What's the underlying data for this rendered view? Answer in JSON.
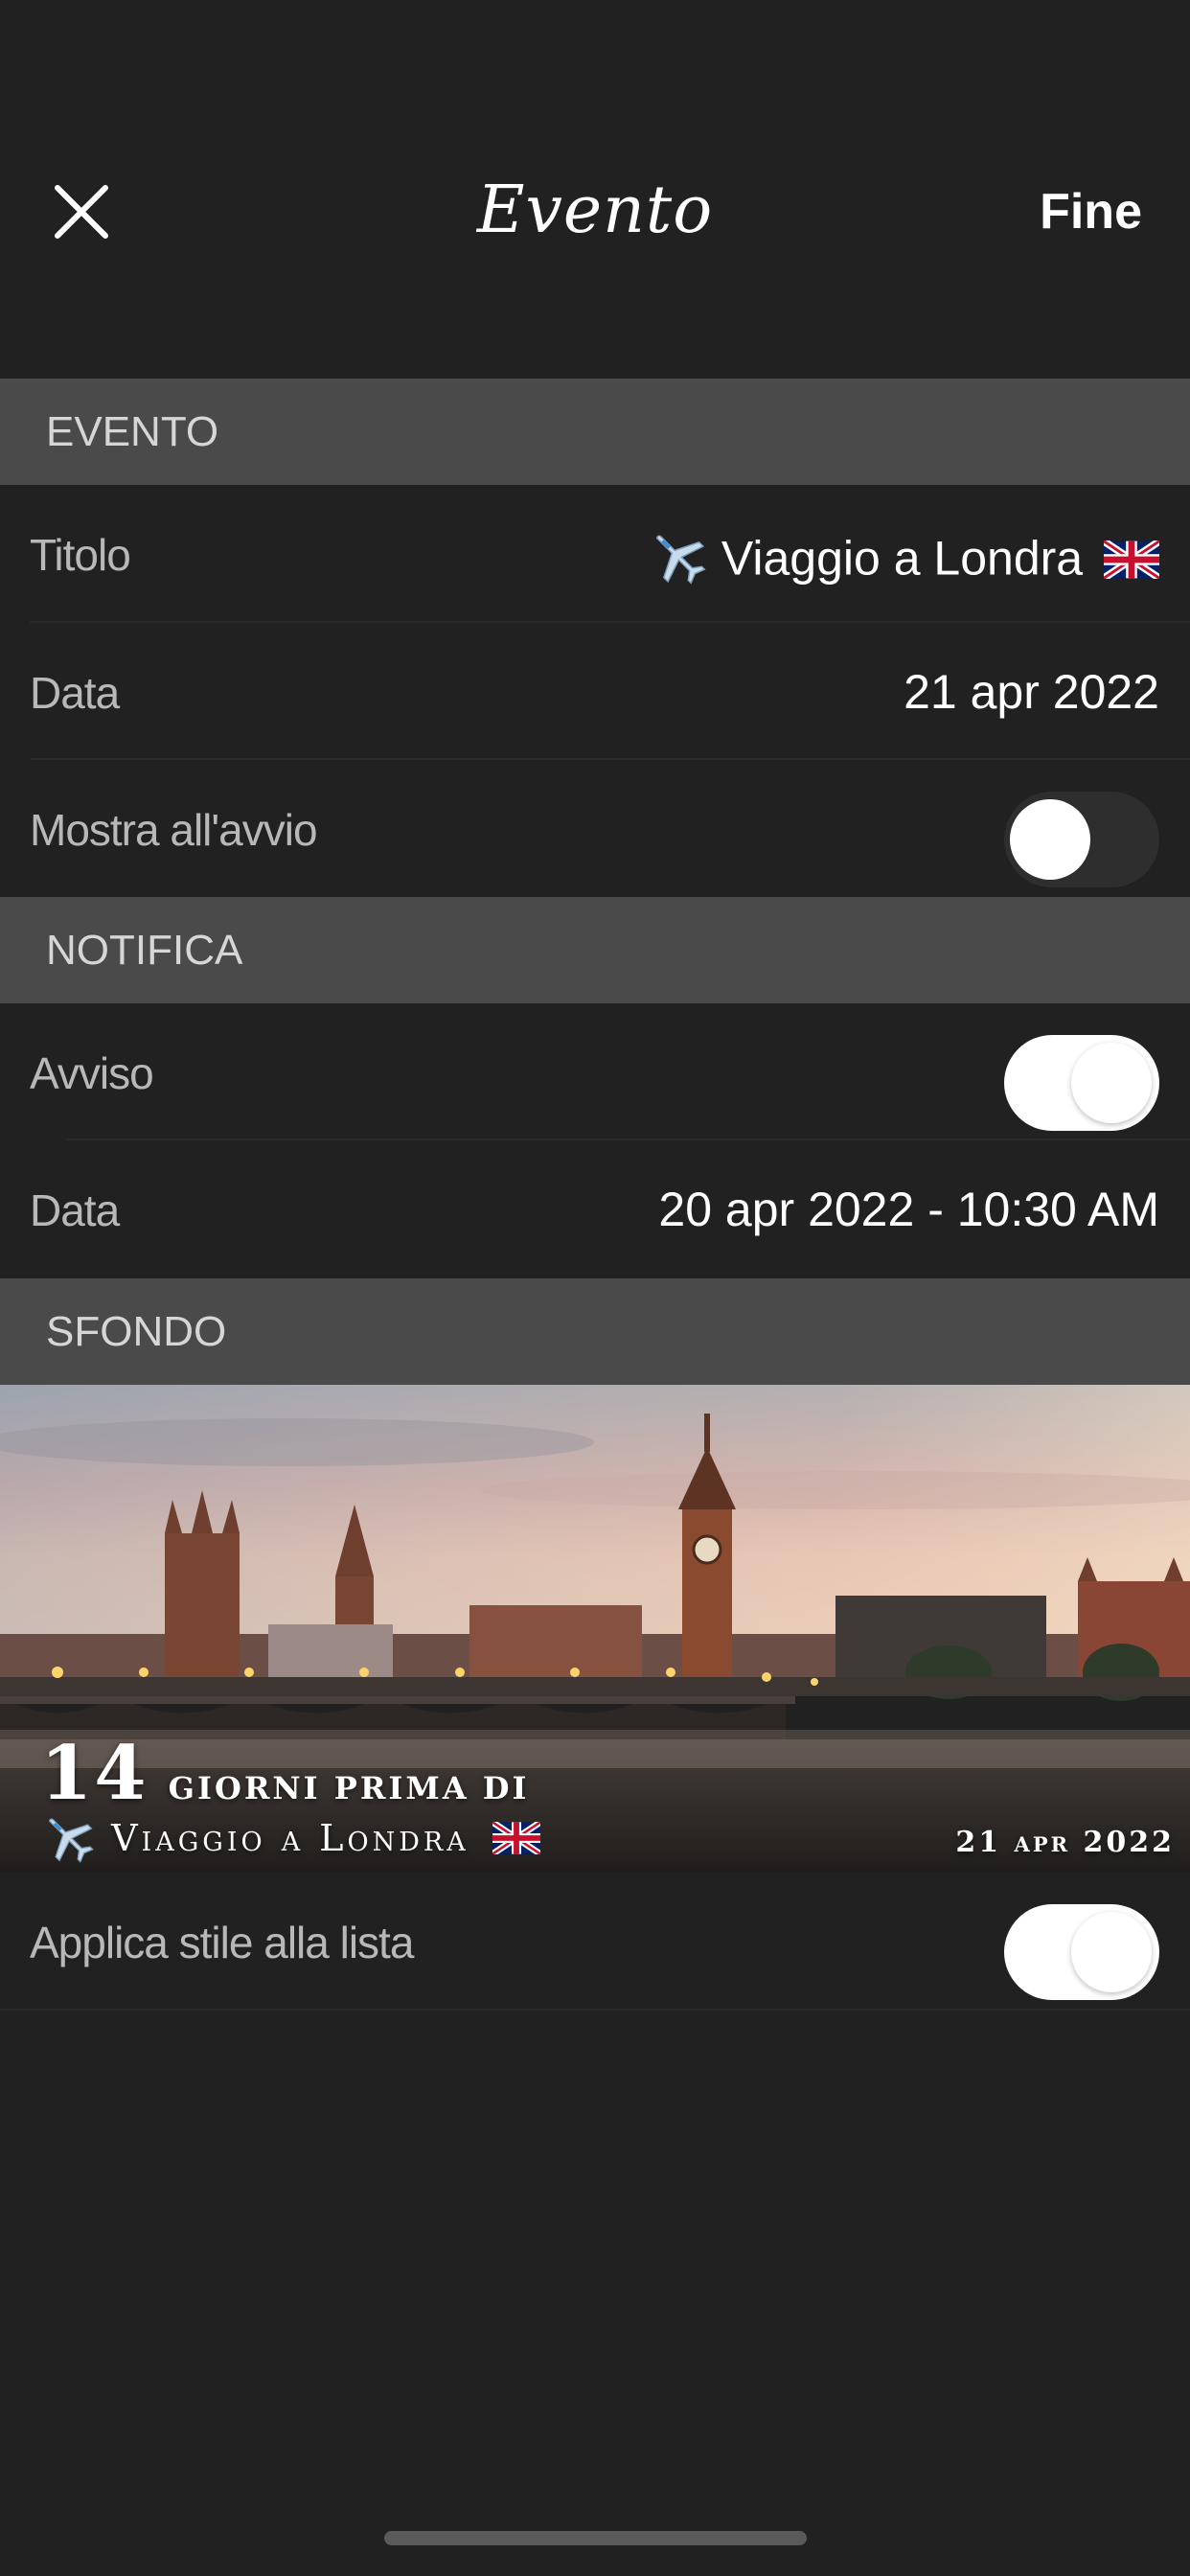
{
  "nav": {
    "title": "Evento",
    "done_label": "Fine",
    "close_icon": "close-icon"
  },
  "sections": {
    "evento": "EVENTO",
    "notifica": "NOTIFICA",
    "sfondo": "SFONDO"
  },
  "event": {
    "title_label": "Titolo",
    "title_value": "Viaggio a Londra",
    "title_icons": [
      "airplane-icon",
      "uk-flag-icon"
    ],
    "date_label": "Data",
    "date_value": "21 apr 2022",
    "show_on_launch_label": "Mostra all'avvio",
    "show_on_launch": false
  },
  "notification": {
    "alert_label": "Avviso",
    "alert_enabled": true,
    "date_label": "Data",
    "date_value": "20 apr 2022 - 10:30 AM"
  },
  "background": {
    "days_number": "14",
    "days_text": "giorni prima di",
    "event_name": "Viaggio a Londra",
    "event_date": "21 apr 2022",
    "apply_style_label": "Applica stile alla lista",
    "apply_style_enabled": true
  },
  "colors": {
    "background": "#212121",
    "section_header": "#4a4a4a",
    "label": "#b8b8b8",
    "value": "#ffffff"
  }
}
